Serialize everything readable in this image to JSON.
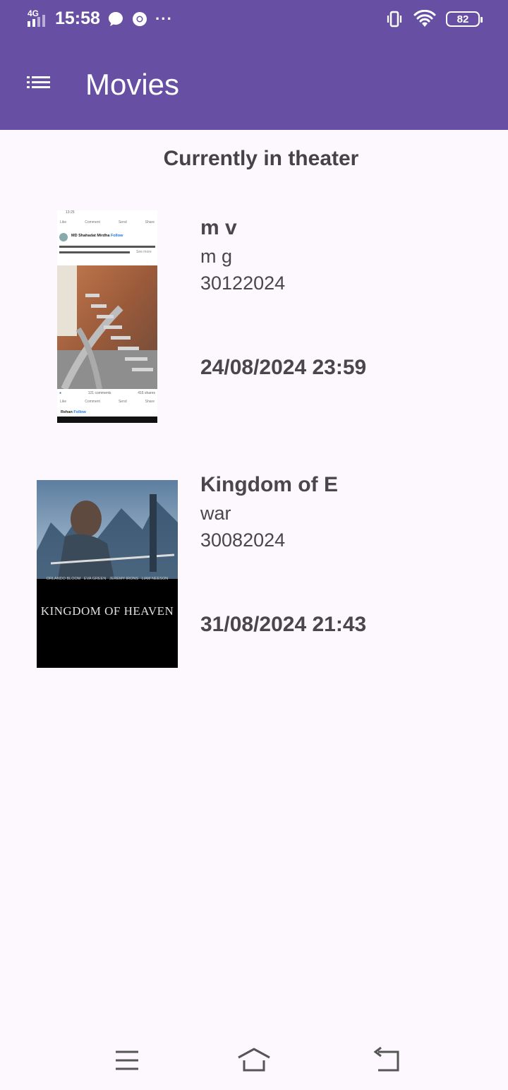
{
  "status_bar": {
    "network": "4G",
    "time": "15:58",
    "battery": "82"
  },
  "toolbar": {
    "title": "Movies",
    "menu_icon": "list-menu-icon"
  },
  "section": {
    "title": "Currently in theater"
  },
  "movies": [
    {
      "title": "m v",
      "genre": "m g",
      "code": "30122024",
      "datetime": "24/08/2024 23:59",
      "poster": {
        "post_author": "MD Shahadat Mirdha",
        "follow": "Follow",
        "comments": "121 comments",
        "shares": "416 shares",
        "like": "Like",
        "comment": "Comment",
        "send": "Send",
        "share": "Share",
        "see_more": "See more",
        "second_author": "Rehan",
        "status_time": "13:25"
      }
    },
    {
      "title": "Kingdom of E",
      "genre": "war",
      "code": "30082024",
      "datetime": "31/08/2024 21:43",
      "poster": {
        "poster_title": "KINGDOM OF HEAVEN",
        "cast": "ORLANDO BLOOM   EVA GREEN   JEREMY IRONS   LIAM NEESON"
      }
    }
  ],
  "nav": {
    "recents_icon": "recents-icon",
    "home_icon": "home-icon",
    "back_icon": "back-icon"
  },
  "colors": {
    "app_bar": "#6750a4",
    "background": "#fdf8fd",
    "text": "#4a464c"
  }
}
